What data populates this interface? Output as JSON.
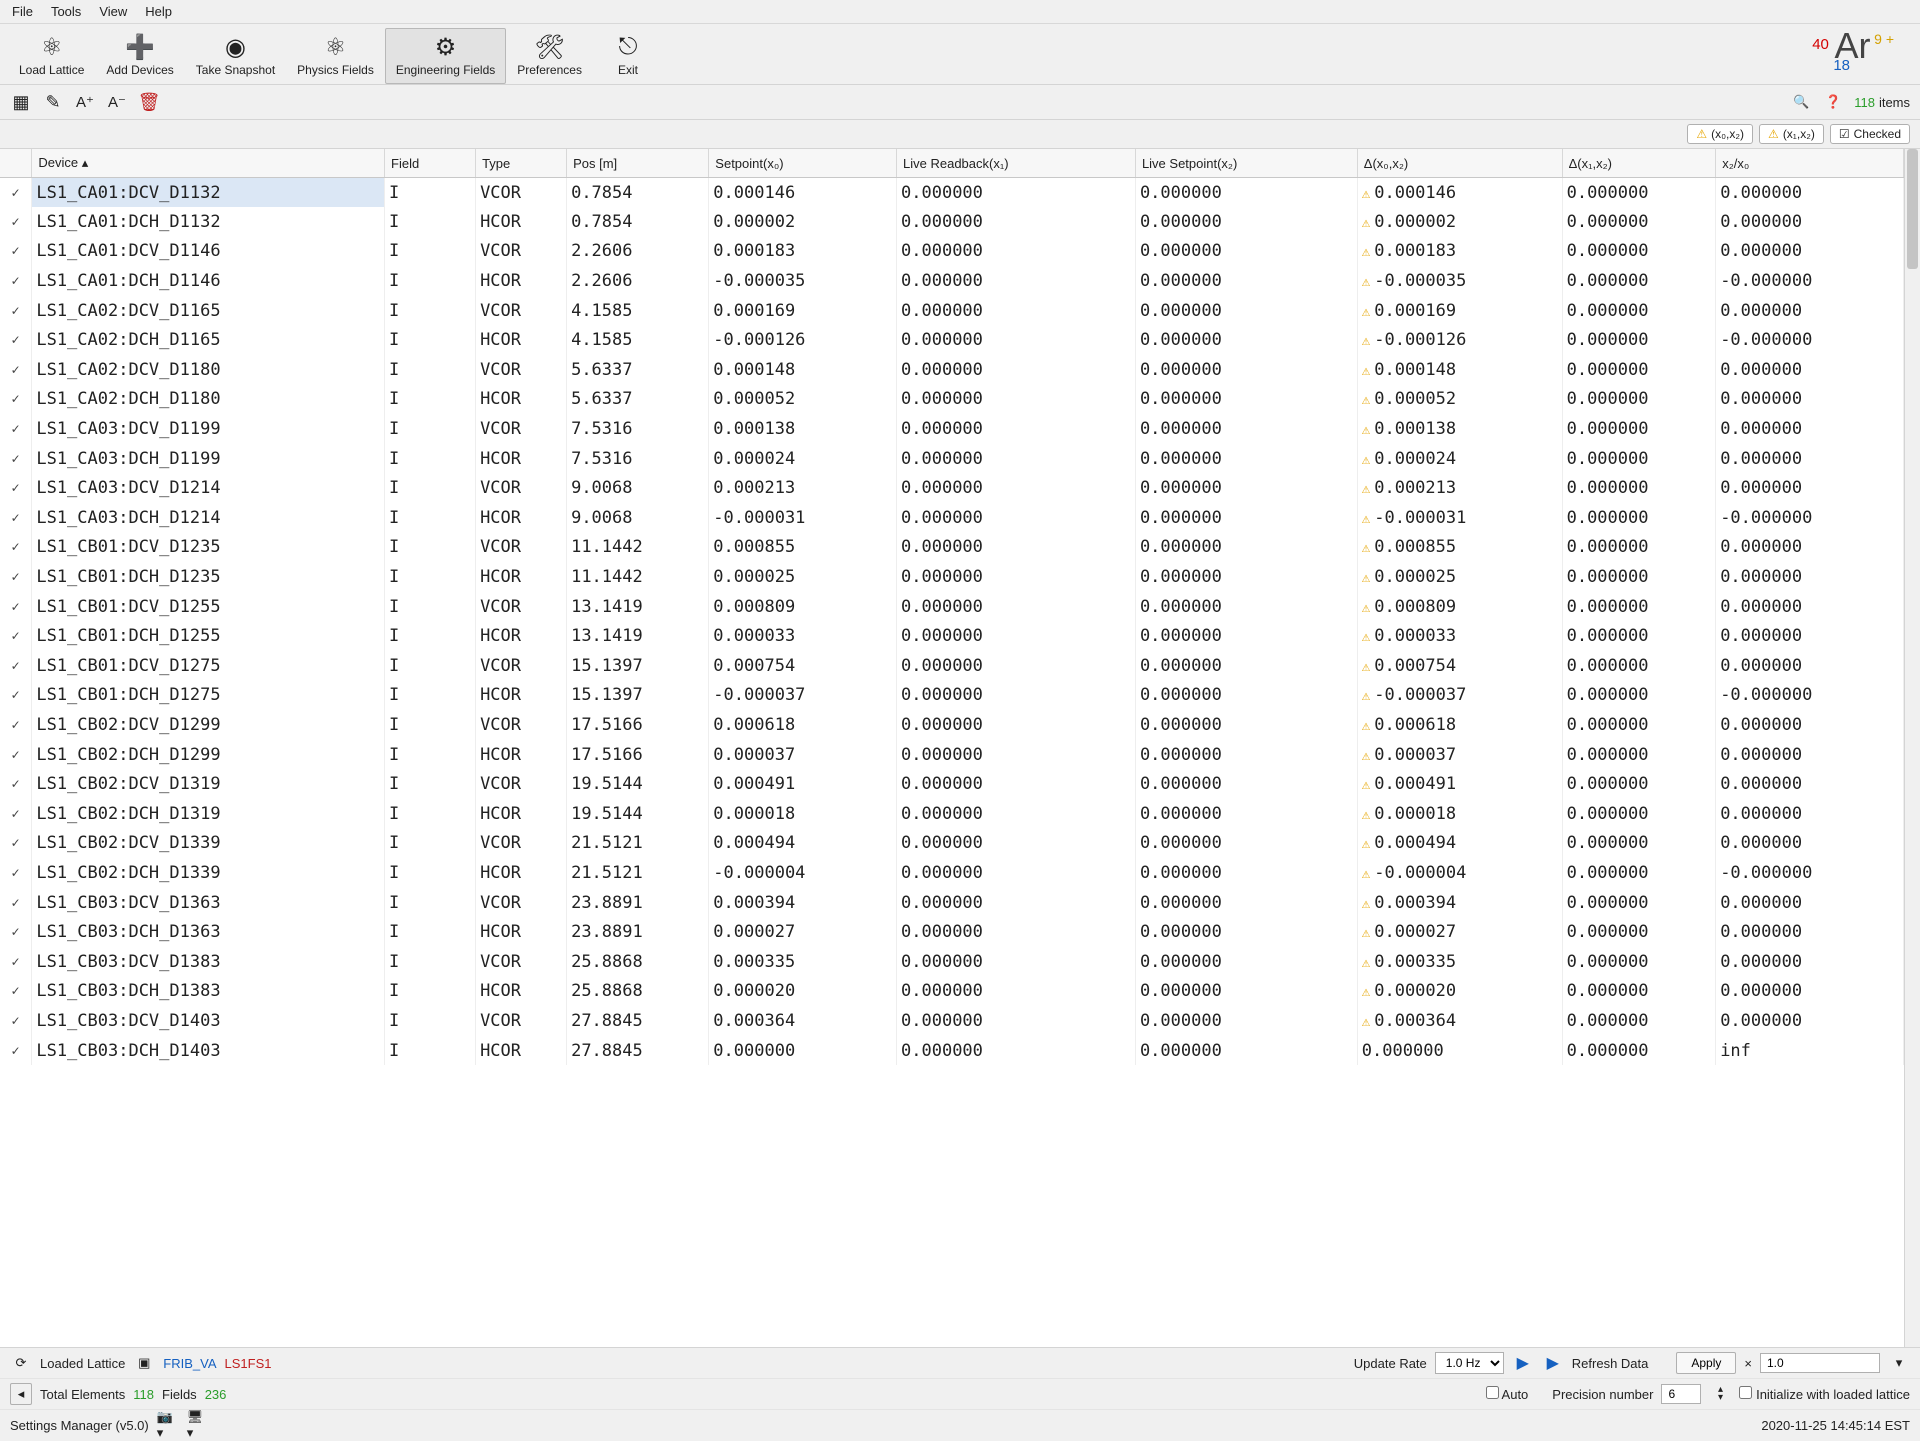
{
  "menu": {
    "items": [
      "File",
      "Tools",
      "View",
      "Help"
    ]
  },
  "toolbar": {
    "items": [
      {
        "label": "Load Lattice",
        "icon": "share"
      },
      {
        "label": "Add Devices",
        "icon": "plus-circle"
      },
      {
        "label": "Take Snapshot",
        "icon": "aperture"
      },
      {
        "label": "Physics Fields",
        "icon": "atom"
      },
      {
        "label": "Engineering Fields",
        "icon": "gear",
        "active": true
      },
      {
        "label": "Preferences",
        "icon": "wrench"
      },
      {
        "label": "Exit",
        "icon": "exit"
      }
    ]
  },
  "ion": {
    "mass": "40",
    "z": "18",
    "symbol": "Ar",
    "charge": "9 +"
  },
  "subbar": {
    "count": "118",
    "count_unit": "items",
    "chip1": "(x₀,x₂)",
    "chip2": "(x₁,x₂)",
    "checked": "Checked"
  },
  "columns": [
    "Device",
    "Field",
    "Type",
    "Pos [m]",
    "Setpoint(x₀)",
    "Live Readback(x₁)",
    "Live Setpoint(x₂)",
    "Δ(x₀,x₂)",
    "Δ(x₁,x₂)",
    "x₂/x₀"
  ],
  "rows": [
    {
      "dev": "LS1_CA01:DCV_D1132",
      "fld": "I",
      "typ": "VCOR",
      "pos": "0.7854",
      "sp": "0.000146",
      "rb": "0.000000",
      "lsp": "0.000000",
      "d02": "0.000146",
      "d12": "0.000000",
      "rat": "0.000000",
      "w": true,
      "sel": true
    },
    {
      "dev": "LS1_CA01:DCH_D1132",
      "fld": "I",
      "typ": "HCOR",
      "pos": "0.7854",
      "sp": "0.000002",
      "rb": "0.000000",
      "lsp": "0.000000",
      "d02": "0.000002",
      "d12": "0.000000",
      "rat": "0.000000",
      "w": true
    },
    {
      "dev": "LS1_CA01:DCV_D1146",
      "fld": "I",
      "typ": "VCOR",
      "pos": "2.2606",
      "sp": "0.000183",
      "rb": "0.000000",
      "lsp": "0.000000",
      "d02": "0.000183",
      "d12": "0.000000",
      "rat": "0.000000",
      "w": true
    },
    {
      "dev": "LS1_CA01:DCH_D1146",
      "fld": "I",
      "typ": "HCOR",
      "pos": "2.2606",
      "sp": "-0.000035",
      "rb": "0.000000",
      "lsp": "0.000000",
      "d02": "-0.000035",
      "d12": "0.000000",
      "rat": "-0.000000",
      "w": true
    },
    {
      "dev": "LS1_CA02:DCV_D1165",
      "fld": "I",
      "typ": "VCOR",
      "pos": "4.1585",
      "sp": "0.000169",
      "rb": "0.000000",
      "lsp": "0.000000",
      "d02": "0.000169",
      "d12": "0.000000",
      "rat": "0.000000",
      "w": true
    },
    {
      "dev": "LS1_CA02:DCH_D1165",
      "fld": "I",
      "typ": "HCOR",
      "pos": "4.1585",
      "sp": "-0.000126",
      "rb": "0.000000",
      "lsp": "0.000000",
      "d02": "-0.000126",
      "d12": "0.000000",
      "rat": "-0.000000",
      "w": true
    },
    {
      "dev": "LS1_CA02:DCV_D1180",
      "fld": "I",
      "typ": "VCOR",
      "pos": "5.6337",
      "sp": "0.000148",
      "rb": "0.000000",
      "lsp": "0.000000",
      "d02": "0.000148",
      "d12": "0.000000",
      "rat": "0.000000",
      "w": true
    },
    {
      "dev": "LS1_CA02:DCH_D1180",
      "fld": "I",
      "typ": "HCOR",
      "pos": "5.6337",
      "sp": "0.000052",
      "rb": "0.000000",
      "lsp": "0.000000",
      "d02": "0.000052",
      "d12": "0.000000",
      "rat": "0.000000",
      "w": true
    },
    {
      "dev": "LS1_CA03:DCV_D1199",
      "fld": "I",
      "typ": "VCOR",
      "pos": "7.5316",
      "sp": "0.000138",
      "rb": "0.000000",
      "lsp": "0.000000",
      "d02": "0.000138",
      "d12": "0.000000",
      "rat": "0.000000",
      "w": true
    },
    {
      "dev": "LS1_CA03:DCH_D1199",
      "fld": "I",
      "typ": "HCOR",
      "pos": "7.5316",
      "sp": "0.000024",
      "rb": "0.000000",
      "lsp": "0.000000",
      "d02": "0.000024",
      "d12": "0.000000",
      "rat": "0.000000",
      "w": true
    },
    {
      "dev": "LS1_CA03:DCV_D1214",
      "fld": "I",
      "typ": "VCOR",
      "pos": "9.0068",
      "sp": "0.000213",
      "rb": "0.000000",
      "lsp": "0.000000",
      "d02": "0.000213",
      "d12": "0.000000",
      "rat": "0.000000",
      "w": true
    },
    {
      "dev": "LS1_CA03:DCH_D1214",
      "fld": "I",
      "typ": "HCOR",
      "pos": "9.0068",
      "sp": "-0.000031",
      "rb": "0.000000",
      "lsp": "0.000000",
      "d02": "-0.000031",
      "d12": "0.000000",
      "rat": "-0.000000",
      "w": true
    },
    {
      "dev": "LS1_CB01:DCV_D1235",
      "fld": "I",
      "typ": "VCOR",
      "pos": "11.1442",
      "sp": "0.000855",
      "rb": "0.000000",
      "lsp": "0.000000",
      "d02": "0.000855",
      "d12": "0.000000",
      "rat": "0.000000",
      "w": true
    },
    {
      "dev": "LS1_CB01:DCH_D1235",
      "fld": "I",
      "typ": "HCOR",
      "pos": "11.1442",
      "sp": "0.000025",
      "rb": "0.000000",
      "lsp": "0.000000",
      "d02": "0.000025",
      "d12": "0.000000",
      "rat": "0.000000",
      "w": true
    },
    {
      "dev": "LS1_CB01:DCV_D1255",
      "fld": "I",
      "typ": "VCOR",
      "pos": "13.1419",
      "sp": "0.000809",
      "rb": "0.000000",
      "lsp": "0.000000",
      "d02": "0.000809",
      "d12": "0.000000",
      "rat": "0.000000",
      "w": true
    },
    {
      "dev": "LS1_CB01:DCH_D1255",
      "fld": "I",
      "typ": "HCOR",
      "pos": "13.1419",
      "sp": "0.000033",
      "rb": "0.000000",
      "lsp": "0.000000",
      "d02": "0.000033",
      "d12": "0.000000",
      "rat": "0.000000",
      "w": true
    },
    {
      "dev": "LS1_CB01:DCV_D1275",
      "fld": "I",
      "typ": "VCOR",
      "pos": "15.1397",
      "sp": "0.000754",
      "rb": "0.000000",
      "lsp": "0.000000",
      "d02": "0.000754",
      "d12": "0.000000",
      "rat": "0.000000",
      "w": true
    },
    {
      "dev": "LS1_CB01:DCH_D1275",
      "fld": "I",
      "typ": "HCOR",
      "pos": "15.1397",
      "sp": "-0.000037",
      "rb": "0.000000",
      "lsp": "0.000000",
      "d02": "-0.000037",
      "d12": "0.000000",
      "rat": "-0.000000",
      "w": true
    },
    {
      "dev": "LS1_CB02:DCV_D1299",
      "fld": "I",
      "typ": "VCOR",
      "pos": "17.5166",
      "sp": "0.000618",
      "rb": "0.000000",
      "lsp": "0.000000",
      "d02": "0.000618",
      "d12": "0.000000",
      "rat": "0.000000",
      "w": true
    },
    {
      "dev": "LS1_CB02:DCH_D1299",
      "fld": "I",
      "typ": "HCOR",
      "pos": "17.5166",
      "sp": "0.000037",
      "rb": "0.000000",
      "lsp": "0.000000",
      "d02": "0.000037",
      "d12": "0.000000",
      "rat": "0.000000",
      "w": true
    },
    {
      "dev": "LS1_CB02:DCV_D1319",
      "fld": "I",
      "typ": "VCOR",
      "pos": "19.5144",
      "sp": "0.000491",
      "rb": "0.000000",
      "lsp": "0.000000",
      "d02": "0.000491",
      "d12": "0.000000",
      "rat": "0.000000",
      "w": true
    },
    {
      "dev": "LS1_CB02:DCH_D1319",
      "fld": "I",
      "typ": "HCOR",
      "pos": "19.5144",
      "sp": "0.000018",
      "rb": "0.000000",
      "lsp": "0.000000",
      "d02": "0.000018",
      "d12": "0.000000",
      "rat": "0.000000",
      "w": true
    },
    {
      "dev": "LS1_CB02:DCV_D1339",
      "fld": "I",
      "typ": "VCOR",
      "pos": "21.5121",
      "sp": "0.000494",
      "rb": "0.000000",
      "lsp": "0.000000",
      "d02": "0.000494",
      "d12": "0.000000",
      "rat": "0.000000",
      "w": true
    },
    {
      "dev": "LS1_CB02:DCH_D1339",
      "fld": "I",
      "typ": "HCOR",
      "pos": "21.5121",
      "sp": "-0.000004",
      "rb": "0.000000",
      "lsp": "0.000000",
      "d02": "-0.000004",
      "d12": "0.000000",
      "rat": "-0.000000",
      "w": true
    },
    {
      "dev": "LS1_CB03:DCV_D1363",
      "fld": "I",
      "typ": "VCOR",
      "pos": "23.8891",
      "sp": "0.000394",
      "rb": "0.000000",
      "lsp": "0.000000",
      "d02": "0.000394",
      "d12": "0.000000",
      "rat": "0.000000",
      "w": true
    },
    {
      "dev": "LS1_CB03:DCH_D1363",
      "fld": "I",
      "typ": "HCOR",
      "pos": "23.8891",
      "sp": "0.000027",
      "rb": "0.000000",
      "lsp": "0.000000",
      "d02": "0.000027",
      "d12": "0.000000",
      "rat": "0.000000",
      "w": true
    },
    {
      "dev": "LS1_CB03:DCV_D1383",
      "fld": "I",
      "typ": "VCOR",
      "pos": "25.8868",
      "sp": "0.000335",
      "rb": "0.000000",
      "lsp": "0.000000",
      "d02": "0.000335",
      "d12": "0.000000",
      "rat": "0.000000",
      "w": true
    },
    {
      "dev": "LS1_CB03:DCH_D1383",
      "fld": "I",
      "typ": "HCOR",
      "pos": "25.8868",
      "sp": "0.000020",
      "rb": "0.000000",
      "lsp": "0.000000",
      "d02": "0.000020",
      "d12": "0.000000",
      "rat": "0.000000",
      "w": true
    },
    {
      "dev": "LS1_CB03:DCV_D1403",
      "fld": "I",
      "typ": "VCOR",
      "pos": "27.8845",
      "sp": "0.000364",
      "rb": "0.000000",
      "lsp": "0.000000",
      "d02": "0.000364",
      "d12": "0.000000",
      "rat": "0.000000",
      "w": true
    },
    {
      "dev": "LS1_CB03:DCH_D1403",
      "fld": "I",
      "typ": "HCOR",
      "pos": "27.8845",
      "sp": "0.000000",
      "rb": "0.000000",
      "lsp": "0.000000",
      "d02": "0.000000",
      "d12": "0.000000",
      "rat": "inf",
      "w": false
    }
  ],
  "status": {
    "loaded_lattice_label": "Loaded Lattice",
    "lattice_link": "FRIB_VA",
    "lattice_seg": "LS1FS1",
    "update_rate_label": "Update Rate",
    "update_rate_value": "1.0 Hz",
    "refresh": "Refresh Data",
    "apply": "Apply",
    "apply_x": "×",
    "apply_val": "1.0",
    "total_elements_label": "Total Elements",
    "total_elements": "118",
    "fields_label": "Fields",
    "fields": "236",
    "auto": "Auto",
    "precision_label": "Precision number",
    "precision": "6",
    "init": "Initialize with loaded lattice",
    "app": "Settings Manager (v5.0)",
    "timestamp": "2020-11-25  14:45:14  EST"
  }
}
